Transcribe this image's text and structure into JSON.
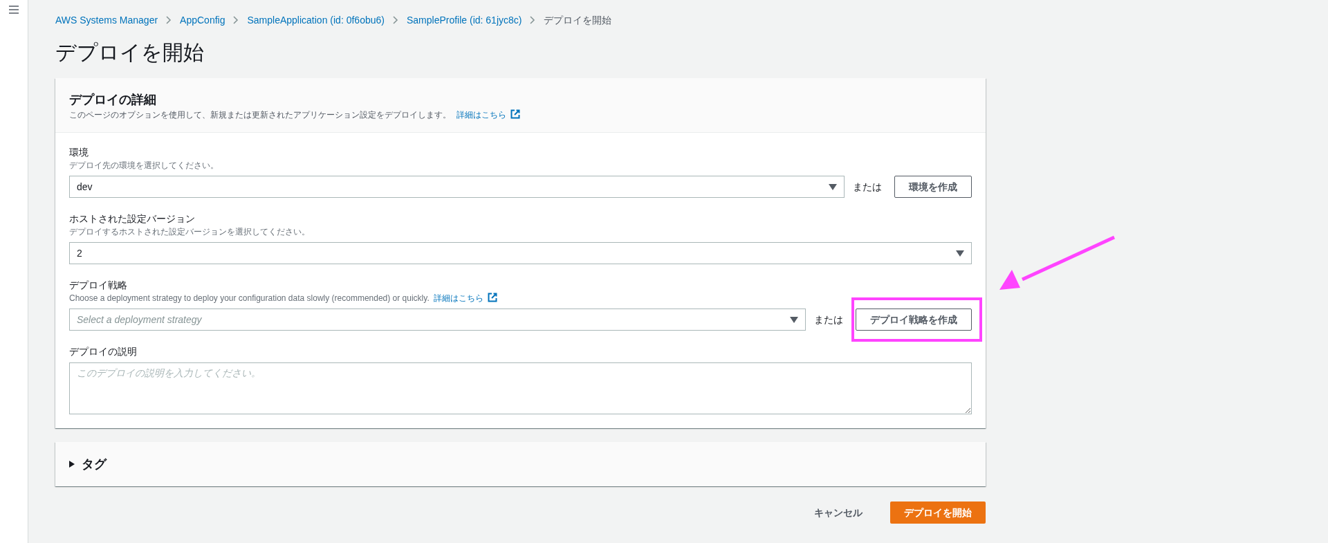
{
  "breadcrumbs": [
    {
      "label": "AWS Systems Manager",
      "current": false
    },
    {
      "label": "AppConfig",
      "current": false
    },
    {
      "label": "SampleApplication (id: 0f6obu6)",
      "current": false
    },
    {
      "label": "SampleProfile (id: 61jyc8c)",
      "current": false
    },
    {
      "label": "デプロイを開始",
      "current": true
    }
  ],
  "page_title": "デプロイを開始",
  "details_card": {
    "title": "デプロイの詳細",
    "description": "このページのオプションを使用して、新規または更新されたアプリケーション設定をデプロイします。",
    "link": "詳細はこちら",
    "fields": [
      {
        "kind": "select",
        "label": "環境",
        "description": "デプロイ先の環境を選択してください。",
        "value": "dev",
        "or_text": "または",
        "create_button": "環境を作成"
      },
      {
        "kind": "select",
        "label": "ホストされた設定バージョン",
        "description": "デプロイするホストされた設定バージョンを選択してください。",
        "value": "2"
      },
      {
        "kind": "select",
        "label": "デプロイ戦略",
        "description": "Choose a deployment strategy to deploy your configuration data slowly (recommended) or quickly.",
        "link": "詳細はこちら",
        "placeholder": "Select a deployment strategy",
        "or_text": "または",
        "create_button": "デプロイ戦略を作成",
        "highlighted": true
      },
      {
        "kind": "textarea",
        "label": "デプロイの説明",
        "placeholder": "このデプロイの説明を入力してください。"
      }
    ]
  },
  "tags_section": {
    "title": "タグ",
    "expanded": false
  },
  "actions": {
    "cancel": "キャンセル",
    "submit": "デプロイを開始"
  }
}
